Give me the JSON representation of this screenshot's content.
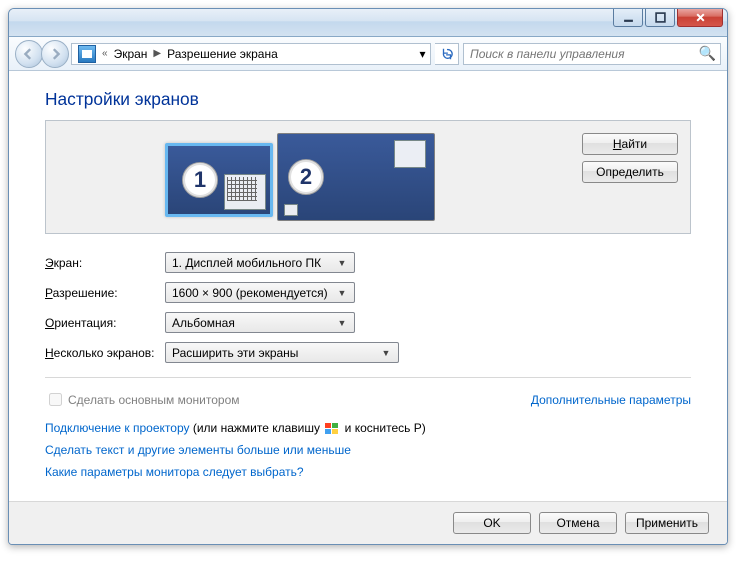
{
  "breadcrumb": {
    "prefix": "«",
    "part1": "Экран",
    "part2": "Разрешение экрана"
  },
  "search": {
    "placeholder": "Поиск в панели управления"
  },
  "heading": "Настройки экранов",
  "monitors": {
    "n1": "1",
    "n2": "2"
  },
  "side": {
    "find": "Найти",
    "find_u": "Н",
    "detect": "Определить"
  },
  "rows": {
    "display_label": "Экран:",
    "display_u": "Э",
    "display_val": "1. Дисплей мобильного ПК",
    "res_label": "Разрешение:",
    "res_u": "Р",
    "res_val": "1600 × 900 (рекомендуется)",
    "orient_label": "Ориентация:",
    "orient_u": "О",
    "orient_val": "Альбомная",
    "multi_label": "Несколько экранов:",
    "multi_u": "Н",
    "multi_val": "Расширить эти экраны"
  },
  "checkbox": "Сделать основным монитором",
  "adv_link": "Дополнительные параметры",
  "lines": {
    "proj1": "Подключение к проектору",
    "proj2": " (или нажмите клавишу ",
    "proj3": " и коснитесь P)",
    "size": "Сделать текст и другие элементы больше или меньше",
    "which": "Какие параметры монитора следует выбрать?"
  },
  "footer": {
    "ok": "OK",
    "cancel": "Отмена",
    "apply": "Применить"
  }
}
